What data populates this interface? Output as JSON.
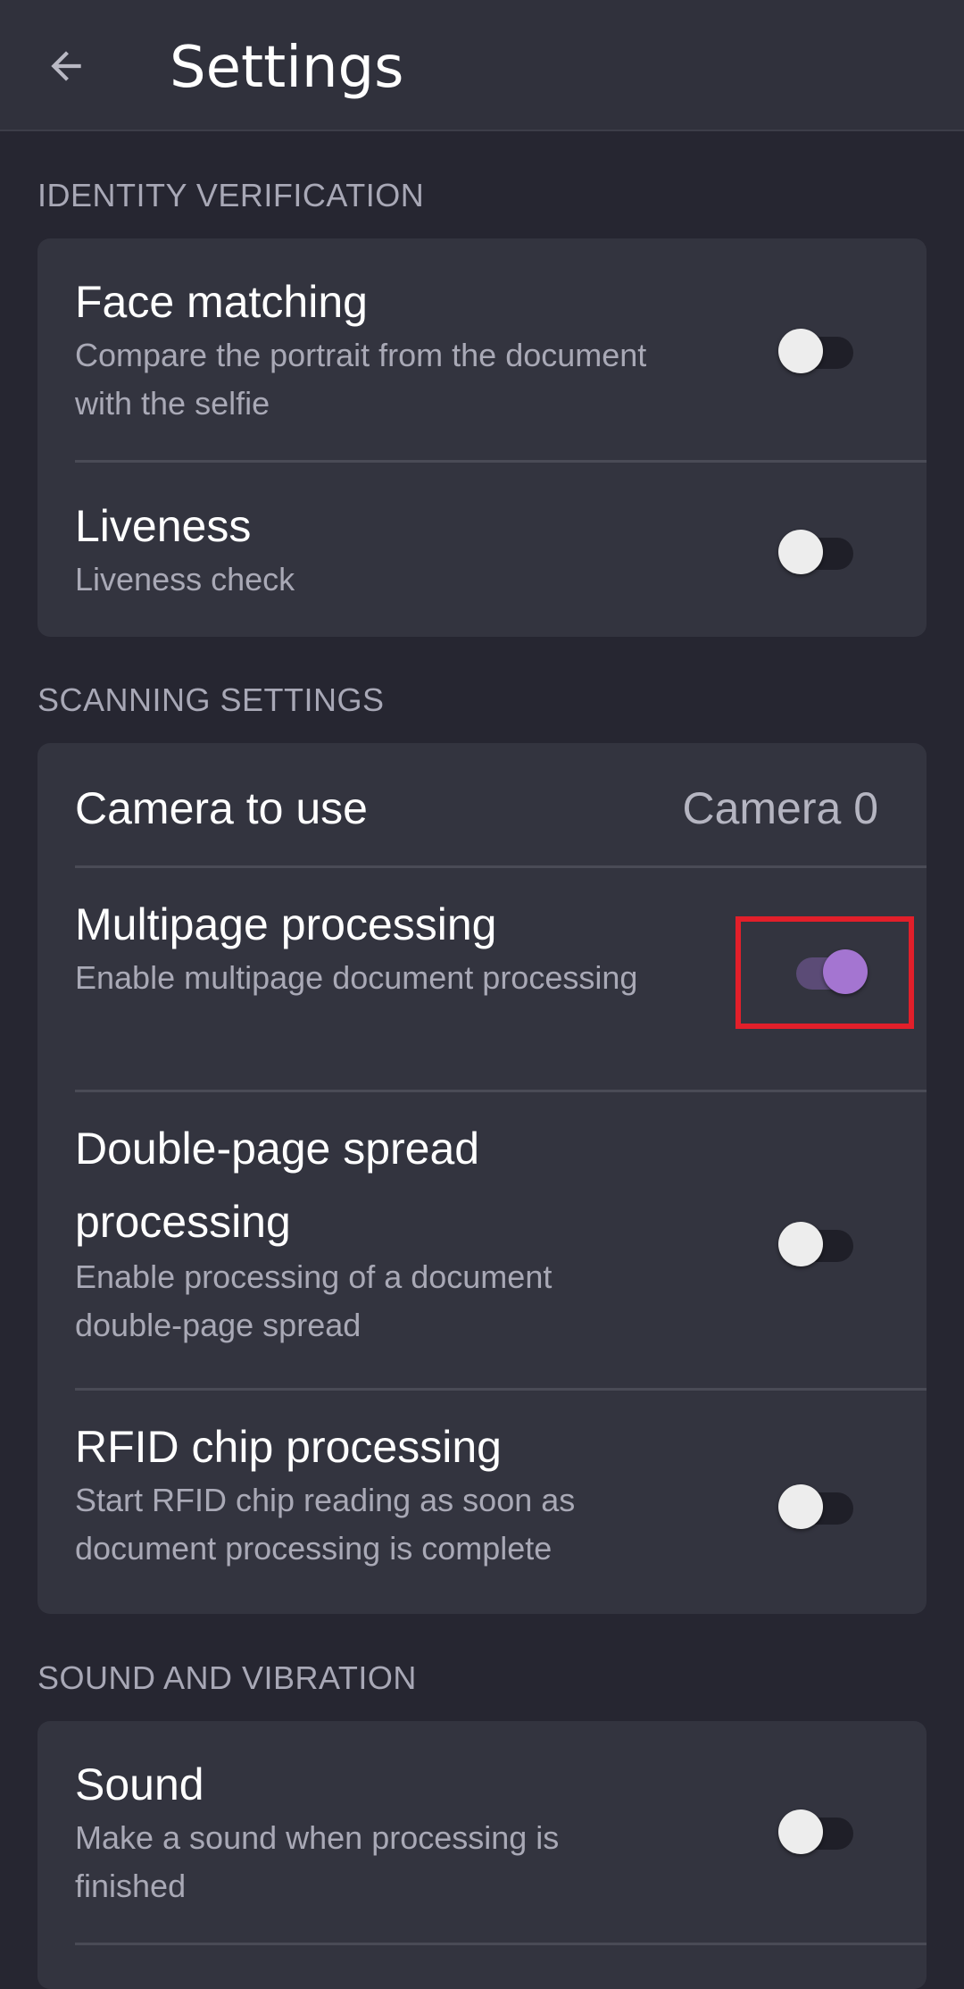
{
  "appbar": {
    "title": "Settings",
    "back_icon": "arrow-left-icon"
  },
  "sections": {
    "identity": {
      "header": "IDENTITY VERIFICATION",
      "face_matching": {
        "label": "Face matching",
        "desc": "Compare the portrait from the document with the selfie",
        "enabled": false
      },
      "liveness": {
        "label": "Liveness",
        "desc": "Liveness check",
        "enabled": false
      }
    },
    "scanning": {
      "header": "SCANNING SETTINGS",
      "camera": {
        "label": "Camera to use",
        "value": "Camera 0"
      },
      "multipage": {
        "label": "Multipage processing",
        "desc": "Enable multipage document processing",
        "enabled": true
      },
      "double_page": {
        "label": "Double-page spread processing",
        "desc": "Enable processing of a document double-page spread",
        "enabled": false
      },
      "rfid": {
        "label": "RFID chip processing",
        "desc": "Start RFID chip reading as soon as document processing is complete",
        "enabled": false
      }
    },
    "sound_vibration": {
      "header": "SOUND AND VIBRATION",
      "sound": {
        "label": "Sound",
        "desc": "Make a sound when processing is finished",
        "enabled": false
      }
    }
  },
  "colors": {
    "background": "#262631",
    "appbar": "#30313c",
    "card": "#33343f",
    "accent": "#a475d1",
    "highlight": "#e21f2a"
  }
}
